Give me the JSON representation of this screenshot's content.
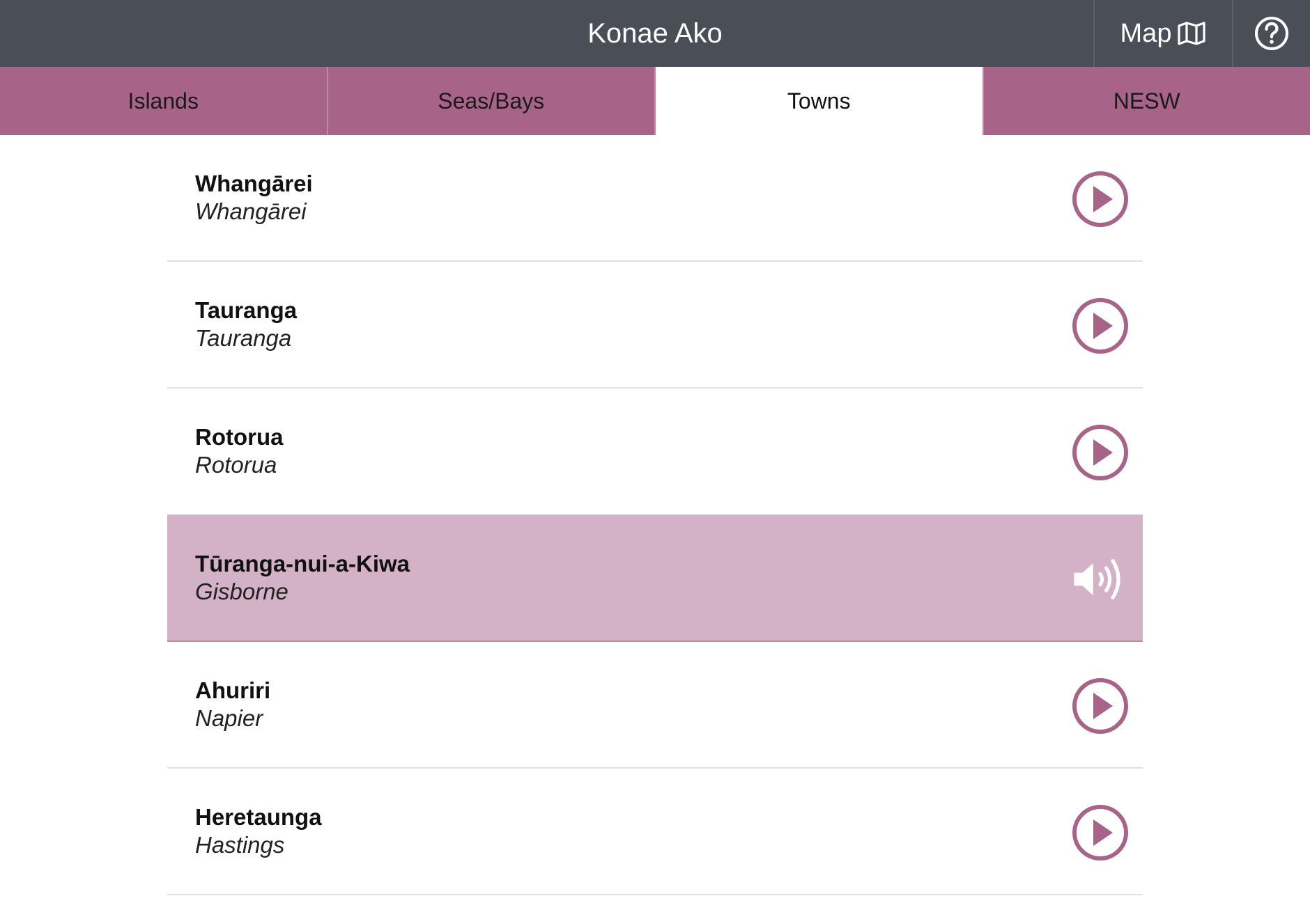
{
  "header": {
    "title": "Konae Ako",
    "map_label": "Map",
    "map_icon": "map-icon",
    "help_icon": "help-icon"
  },
  "tabs": [
    {
      "label": "Islands",
      "active": false
    },
    {
      "label": "Seas/Bays",
      "active": false
    },
    {
      "label": "Towns",
      "active": true
    },
    {
      "label": "NESW",
      "active": false
    }
  ],
  "items": [
    {
      "primary": "Whangārei",
      "secondary": "Whangārei",
      "playing": false
    },
    {
      "primary": "Tauranga",
      "secondary": "Tauranga",
      "playing": false
    },
    {
      "primary": "Rotorua",
      "secondary": "Rotorua",
      "playing": false
    },
    {
      "primary": "Tūranga-nui-a-Kiwa",
      "secondary": "Gisborne",
      "playing": true
    },
    {
      "primary": "Ahuriri",
      "secondary": "Napier",
      "playing": false
    },
    {
      "primary": "Heretaunga",
      "secondary": "Hastings",
      "playing": false
    }
  ],
  "colors": {
    "header_bg": "#4a4e57",
    "tab_bg": "#a86488",
    "active_row_bg": "#d3b1c7",
    "accent": "#a86488"
  }
}
